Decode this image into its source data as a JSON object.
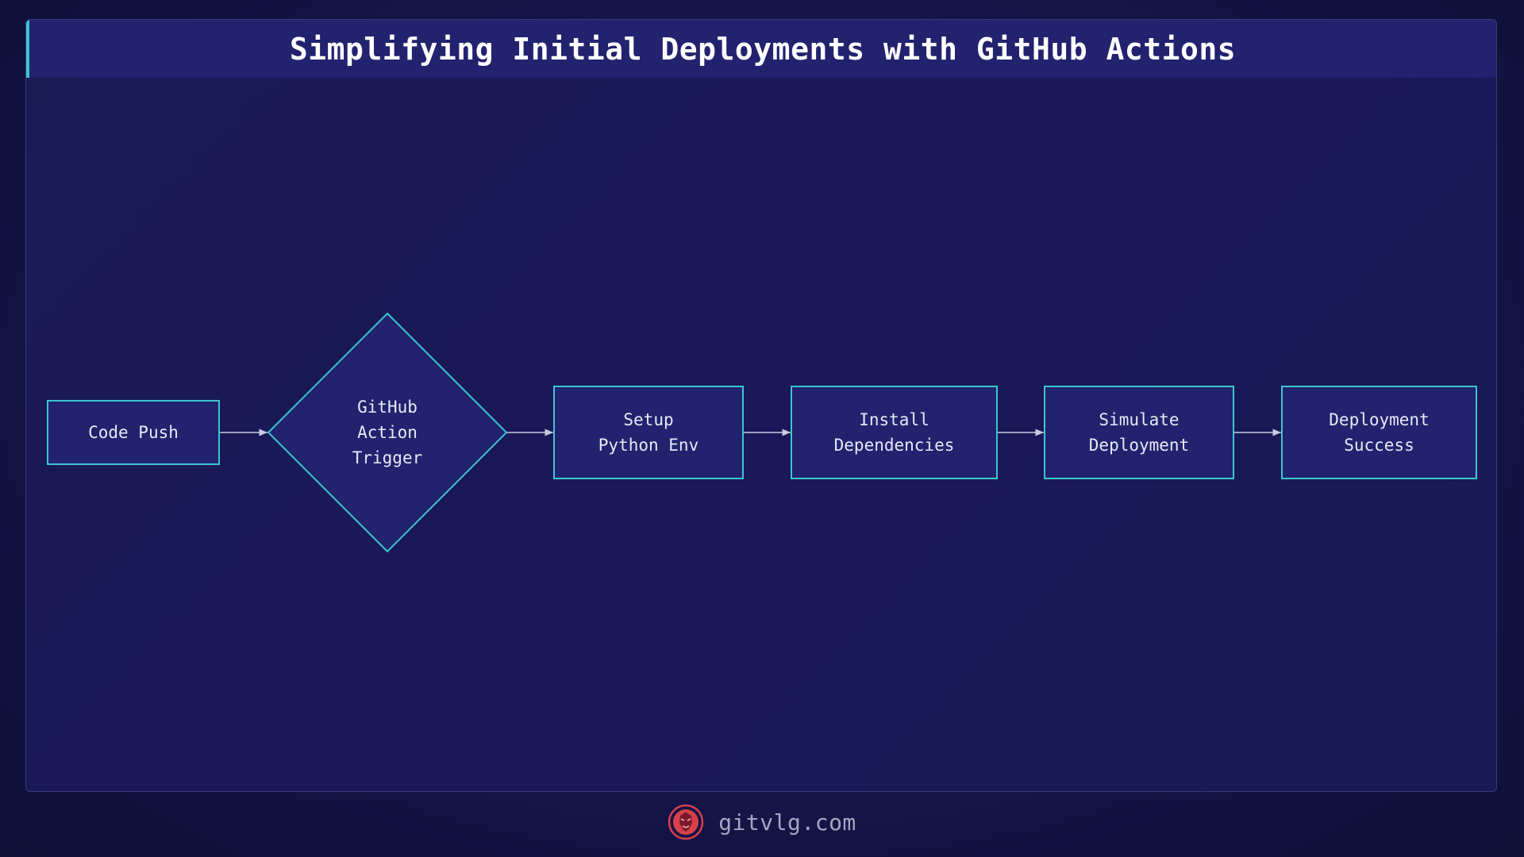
{
  "title": "Simplifying Initial Deployments with GitHub Actions",
  "colors": {
    "background": "#15154a",
    "header": "#22226f",
    "node_fill": "#22226f",
    "node_border": "#3cc6cf",
    "arrow": "#c9cbe0",
    "text": "#e8e9f5",
    "logo": "#d8404a"
  },
  "diagram": {
    "nodes": [
      {
        "id": "code-push",
        "shape": "rect",
        "lines": [
          "Code Push"
        ]
      },
      {
        "id": "github-action-trigger",
        "shape": "diamond",
        "lines": [
          "GitHub",
          "Action",
          "Trigger"
        ]
      },
      {
        "id": "setup-python-env",
        "shape": "rect",
        "lines": [
          "Setup",
          "Python Env"
        ]
      },
      {
        "id": "install-dependencies",
        "shape": "rect",
        "lines": [
          "Install",
          "Dependencies"
        ]
      },
      {
        "id": "simulate-deployment",
        "shape": "rect",
        "lines": [
          "Simulate",
          "Deployment"
        ]
      },
      {
        "id": "deployment-success",
        "shape": "rect",
        "lines": [
          "Deployment",
          "Success"
        ]
      }
    ],
    "edges": [
      {
        "from": "code-push",
        "to": "github-action-trigger"
      },
      {
        "from": "github-action-trigger",
        "to": "setup-python-env"
      },
      {
        "from": "setup-python-env",
        "to": "install-dependencies"
      },
      {
        "from": "install-dependencies",
        "to": "simulate-deployment"
      },
      {
        "from": "simulate-deployment",
        "to": "deployment-success"
      }
    ]
  },
  "footer": {
    "logo_icon": "lion-head-icon",
    "site": "gitvlg.com"
  }
}
